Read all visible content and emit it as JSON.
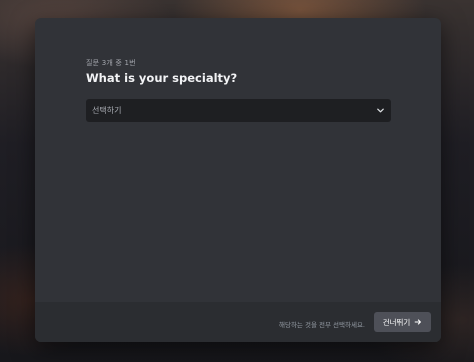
{
  "onboarding": {
    "progress_text": "질문 3개 중 1번",
    "question": "What is your specialty?",
    "select": {
      "placeholder": "선택하기",
      "icon": "chevron-down-icon"
    },
    "footer": {
      "hint": "해당하는 것을 전부 선택하세요.",
      "skip_label": "건너뛰기",
      "skip_icon": "arrow-right-icon"
    }
  },
  "colors": {
    "modal_bg": "#313338",
    "footer_bg": "#2b2d31",
    "select_bg": "#1e1f22",
    "button_bg": "#4e5058",
    "heading_text": "#f2f3f5",
    "muted_text": "#949ba4"
  }
}
